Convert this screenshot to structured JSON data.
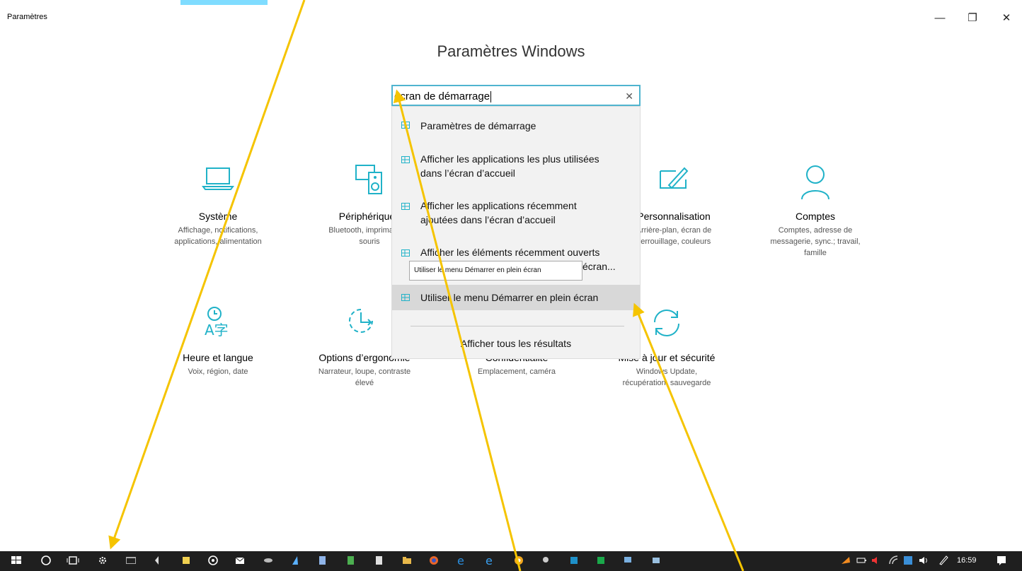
{
  "window": {
    "title": "Paramètres",
    "controls": {
      "minimize": "—",
      "restore": "❐",
      "close": "✕"
    }
  },
  "page": {
    "title": "Paramètres Windows"
  },
  "search": {
    "value": "écran de démarrage",
    "clear_icon": "close-icon"
  },
  "suggestions": [
    {
      "icon": "settings-item-icon",
      "lines": [
        "Paramètres de démarrage"
      ]
    },
    {
      "icon": "settings-item-icon",
      "lines": [
        "Afficher les applications les plus utilisées",
        "dans l’écran d’accueil"
      ]
    },
    {
      "icon": "settings-item-icon",
      "lines": [
        "Afficher les applications récemment",
        "ajoutées dans l’écran d’accueil"
      ]
    },
    {
      "icon": "settings-item-icon",
      "lines": [
        "Afficher les éléments récemment ouverts",
        "écran..."
      ]
    },
    {
      "icon": "settings-item-icon",
      "lines": [
        "Utiliser le menu Démarrer en plein écran"
      ]
    }
  ],
  "show_all_results": "Afficher tous les résultats",
  "tooltip": "Utiliser le menu Démarrer en plein écran",
  "categories": [
    {
      "icon": "laptop-icon",
      "name": "Système",
      "desc": [
        "Affichage, notifications,",
        "applications, alimentation"
      ]
    },
    {
      "icon": "devices-icon",
      "name": "Périphériques",
      "desc": [
        "Bluetooth, imprimantes,",
        "souris"
      ]
    },
    {
      "icon": "personalization-icon",
      "name": "Personnalisation",
      "desc": [
        "Arrière-plan, écran de",
        "verrouillage, couleurs"
      ]
    },
    {
      "icon": "person-icon",
      "name": "Comptes",
      "desc": [
        "Comptes, adresse de",
        "messagerie, sync.; travail,",
        "famille"
      ]
    },
    {
      "icon": "language-icon",
      "name": "Heure et langue",
      "desc": [
        "Voix, région, date"
      ]
    },
    {
      "icon": "accessibility-icon",
      "name": "Options d’ergonomie",
      "desc": [
        "Narrateur, loupe, contraste",
        "élevé"
      ]
    },
    {
      "icon": "lock-icon",
      "name": "Confidentialité",
      "desc": [
        "Emplacement, caméra"
      ]
    },
    {
      "icon": "sync-icon",
      "name": "Mise à jour et sécurité",
      "desc": [
        "Windows Update,",
        "récupération, sauvegarde"
      ]
    }
  ],
  "taskbar": {
    "time": "16:59"
  },
  "colors": {
    "accent": "#20b2c8",
    "highlight": "#d8d8d8",
    "taskbar": "#1f1f1f",
    "annotation": "#f5c400"
  }
}
